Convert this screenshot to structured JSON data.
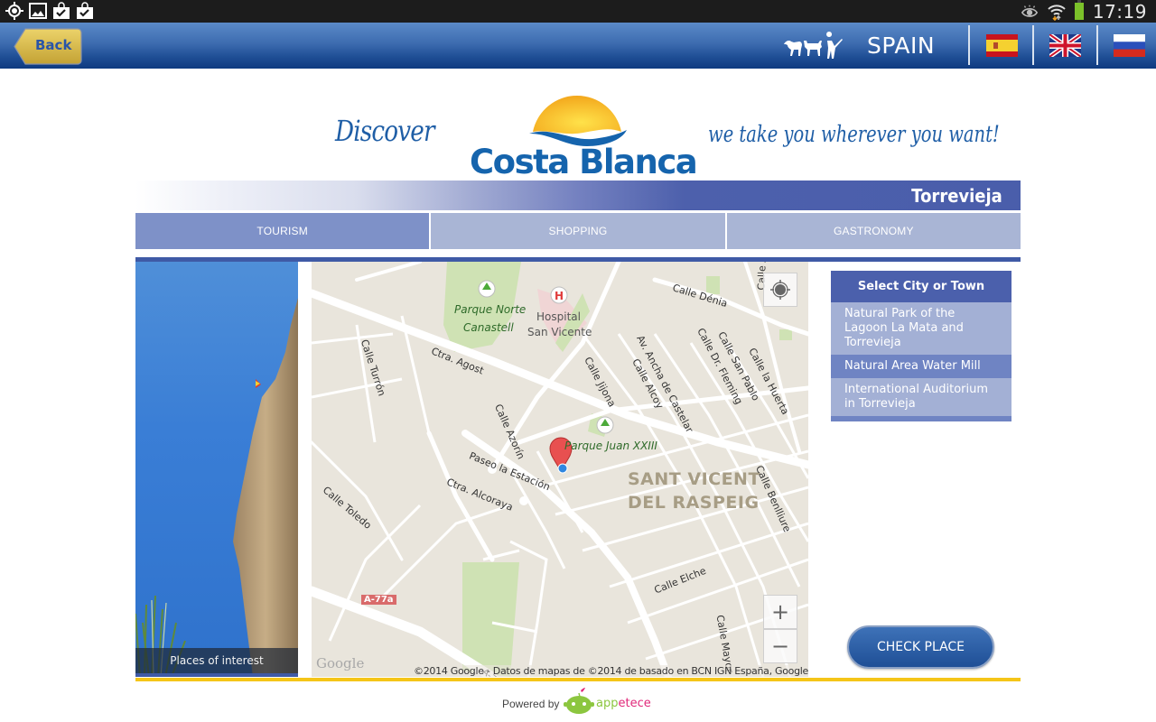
{
  "status_bar": {
    "left_icons": [
      "gps-icon",
      "gallery-icon",
      "shopping-bag-check-icon",
      "shopping-bag-check-icon"
    ],
    "right_icons": [
      "eye-icon",
      "wifi-icon",
      "battery-icon"
    ],
    "time": "17:19"
  },
  "app_bar": {
    "back_label": "Back",
    "country": "SPAIN",
    "languages": [
      {
        "name": "spanish",
        "icon": "flag-spain-icon"
      },
      {
        "name": "english",
        "icon": "flag-uk-icon"
      },
      {
        "name": "russian",
        "icon": "flag-russia-icon"
      }
    ]
  },
  "brand": {
    "discover": "Discover",
    "logo_text": "Costa Blanca",
    "slogan": "we take you wherever you want!",
    "city": "Torrevieja"
  },
  "tabs": [
    {
      "label": "TOURISM",
      "active": true
    },
    {
      "label": "SHOPPING",
      "active": false
    },
    {
      "label": "GASTRONOMY",
      "active": false
    }
  ],
  "photo": {
    "caption": "Places of interest"
  },
  "map": {
    "labels": {
      "parque_norte_1": "Parque Norte",
      "parque_norte_2": "Canastell",
      "hospital_1": "Hospital",
      "hospital_2": "San Vicente",
      "calle_denia": "Calle Dénia",
      "calle_turron": "Calle Turrón",
      "ctra_agost": "Ctra. Agost",
      "calle_jijona": "Calle Jijona",
      "calle_alcoy": "Calle Alcoy",
      "av_castelar": "Av. Ancha de Castelar",
      "calle_fleming": "Calle Dr. Fleming",
      "calle_san_pablo": "Calle San Pablo",
      "calle_huerta": "Calle la Huerta",
      "calle_altea": "Calle Altea",
      "calle_azorin": "Calle Azorín",
      "parque_juan": "Parque Juan XXIII",
      "paseo_estacion": "Paseo la Estación",
      "ctra_alcoraya": "Ctra. Alcoraya",
      "calle_toledo": "Calle Toledo",
      "sant_vicent_1": "SANT VICENT",
      "sant_vicent_2": "DEL RASPEIG",
      "calle_benlliure": "Calle Benlliure",
      "calle_elche": "Calle Elche",
      "calle_mayor": "Calle Mayor",
      "road_badge": "A-77a",
      "a77": "A-77"
    },
    "zoom_in": "+",
    "zoom_out": "−",
    "google": "Google",
    "attribution": "©2014 Google - Datos de mapas de ©2014 de basado en BCN IGN España, Google"
  },
  "side_list": {
    "header": "Select City or Town",
    "items": [
      "Natural Park of the Lagoon La Mata and Torrevieja",
      "Natural Area Water Mill",
      "International Auditorium in Torrevieja"
    ]
  },
  "check_button": "CHECK PLACE",
  "footer": {
    "powered_by": "Powered by",
    "brand_app": "app",
    "brand_etece": "etece"
  }
}
